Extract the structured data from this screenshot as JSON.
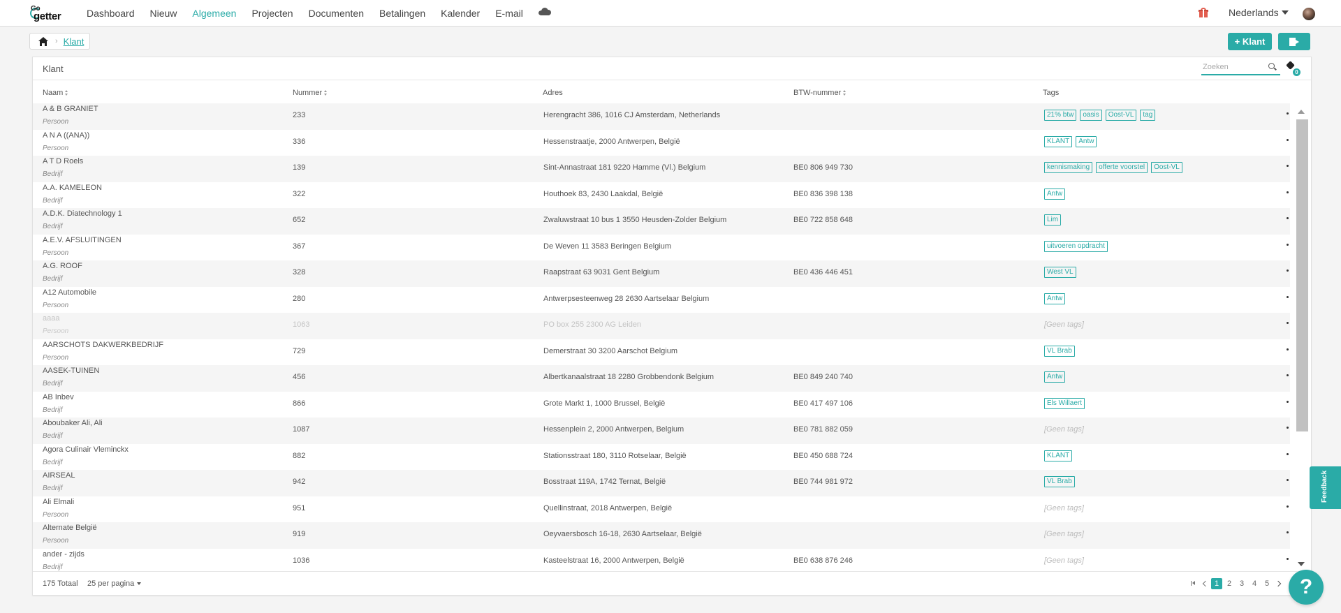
{
  "nav": {
    "logo_go": "Go",
    "logo_getter": "getter",
    "items": [
      {
        "label": "Dashboard",
        "active": false
      },
      {
        "label": "Nieuw",
        "active": false
      },
      {
        "label": "Algemeen",
        "active": true
      },
      {
        "label": "Projecten",
        "active": false
      },
      {
        "label": "Documenten",
        "active": false
      },
      {
        "label": "Betalingen",
        "active": false
      },
      {
        "label": "Kalender",
        "active": false
      },
      {
        "label": "E-mail",
        "active": false
      }
    ],
    "language": "Nederlands"
  },
  "breadcrumb": {
    "current": "Klant"
  },
  "actions": {
    "add_label": "+ Klant"
  },
  "panel": {
    "title": "Klant",
    "search_placeholder": "Zoeken",
    "tag_filter_count": "0",
    "columns": {
      "name": "Naam",
      "number": "Nummer",
      "address": "Adres",
      "vat": "BTW-nummer",
      "tags": "Tags"
    },
    "no_tags_label": "[Geen tags]"
  },
  "rows": [
    {
      "name": "A & B GRANIET",
      "type": "Persoon",
      "number": "233",
      "address": "Herengracht 386, 1016 CJ Amsterdam, Netherlands",
      "vat": "",
      "tags": [
        "21% btw",
        "oasis",
        "Oost-VL",
        "tag"
      ],
      "muted": false
    },
    {
      "name": "A N A ((ANA))",
      "type": "Persoon",
      "number": "336",
      "address": "Hessenstraatje, 2000 Antwerpen, België",
      "vat": "",
      "tags": [
        "KLANT",
        "Antw"
      ],
      "muted": false
    },
    {
      "name": "A T D Roels",
      "type": "Bedrijf",
      "number": "139",
      "address": "Sint-Annastraat 181 9220 Hamme (Vl.) Belgium",
      "vat": "BE0 806 949 730",
      "tags": [
        "kennismaking",
        "offerte voorstel",
        "Oost-VL"
      ],
      "muted": false
    },
    {
      "name": "A.A. KAMELEON",
      "type": "Bedrijf",
      "number": "322",
      "address": "Houthoek 83, 2430 Laakdal, België",
      "vat": "BE0 836 398 138",
      "tags": [
        "Antw"
      ],
      "muted": false
    },
    {
      "name": "A.D.K. Diatechnology 1",
      "type": "Bedrijf",
      "number": "652",
      "address": "Zwaluwstraat 10 bus 1 3550 Heusden-Zolder Belgium",
      "vat": "BE0 722 858 648",
      "tags": [
        "Lim"
      ],
      "muted": false
    },
    {
      "name": "A.E.V. AFSLUITINGEN",
      "type": "Persoon",
      "number": "367",
      "address": "De Weven 11 3583 Beringen Belgium",
      "vat": "",
      "tags": [
        "uitvoeren opdracht"
      ],
      "muted": false
    },
    {
      "name": "A.G. ROOF",
      "type": "Bedrijf",
      "number": "328",
      "address": "Raapstraat 63 9031 Gent Belgium",
      "vat": "BE0 436 446 451",
      "tags": [
        "West VL"
      ],
      "muted": false
    },
    {
      "name": "A12 Automobile",
      "type": "Persoon",
      "number": "280",
      "address": "Antwerpsesteenweg 28 2630 Aartselaar Belgium",
      "vat": "",
      "tags": [
        "Antw"
      ],
      "muted": false
    },
    {
      "name": "aaaa",
      "type": "Persoon",
      "number": "1063",
      "address": "PO box 255 2300 AG Leiden",
      "vat": "",
      "tags": [],
      "muted": true
    },
    {
      "name": "AARSCHOTS DAKWERKBEDRIJF",
      "type": "Persoon",
      "number": "729",
      "address": "Demerstraat 30 3200 Aarschot Belgium",
      "vat": "",
      "tags": [
        "VL Brab"
      ],
      "muted": false
    },
    {
      "name": "AASEK-TUINEN",
      "type": "Bedrijf",
      "number": "456",
      "address": "Albertkanaalstraat 18 2280 Grobbendonk Belgium",
      "vat": "BE0 849 240 740",
      "tags": [
        "Antw"
      ],
      "muted": false
    },
    {
      "name": "AB Inbev",
      "type": "Bedrijf",
      "number": "866",
      "address": "Grote Markt 1, 1000 Brussel, België",
      "vat": "BE0 417 497 106",
      "tags": [
        "Els Willaert"
      ],
      "muted": false
    },
    {
      "name": "Aboubaker Ali, Ali",
      "type": "Bedrijf",
      "number": "1087",
      "address": "Hessenplein 2, 2000 Antwerpen, Belgium",
      "vat": "BE0 781 882 059",
      "tags": [],
      "muted": false
    },
    {
      "name": "Agora Culinair Vleminckx",
      "type": "Bedrijf",
      "number": "882",
      "address": "Stationsstraat 180, 3110 Rotselaar, België",
      "vat": "BE0 450 688 724",
      "tags": [
        "KLANT"
      ],
      "muted": false
    },
    {
      "name": "AIRSEAL",
      "type": "Bedrijf",
      "number": "942",
      "address": "Bosstraat 119A, 1742 Ternat, België",
      "vat": "BE0 744 981 972",
      "tags": [
        "VL Brab"
      ],
      "muted": false
    },
    {
      "name": "Ali Elmali",
      "type": "Persoon",
      "number": "951",
      "address": "Quellinstraat, 2018 Antwerpen, België",
      "vat": "",
      "tags": [],
      "muted": false
    },
    {
      "name": "Alternate België",
      "type": "Persoon",
      "number": "919",
      "address": "Oeyvaersbosch 16-18, 2630 Aartselaar, België",
      "vat": "",
      "tags": [],
      "muted": false
    },
    {
      "name": "ander - zijds",
      "type": "Bedrijf",
      "number": "1036",
      "address": "Kasteelstraat 16, 2000 Antwerpen, België",
      "vat": "BE0 638 876 246",
      "tags": [],
      "muted": false
    }
  ],
  "footer": {
    "total": "175 Totaal",
    "per_page": "25 per pagina",
    "pages": [
      "1",
      "2",
      "3",
      "4",
      "5"
    ],
    "current_page": "1"
  },
  "feedback_label": "Feedback",
  "help_label": "?",
  "colors": {
    "accent": "#2aaba7",
    "gift": "#e25d4e"
  }
}
